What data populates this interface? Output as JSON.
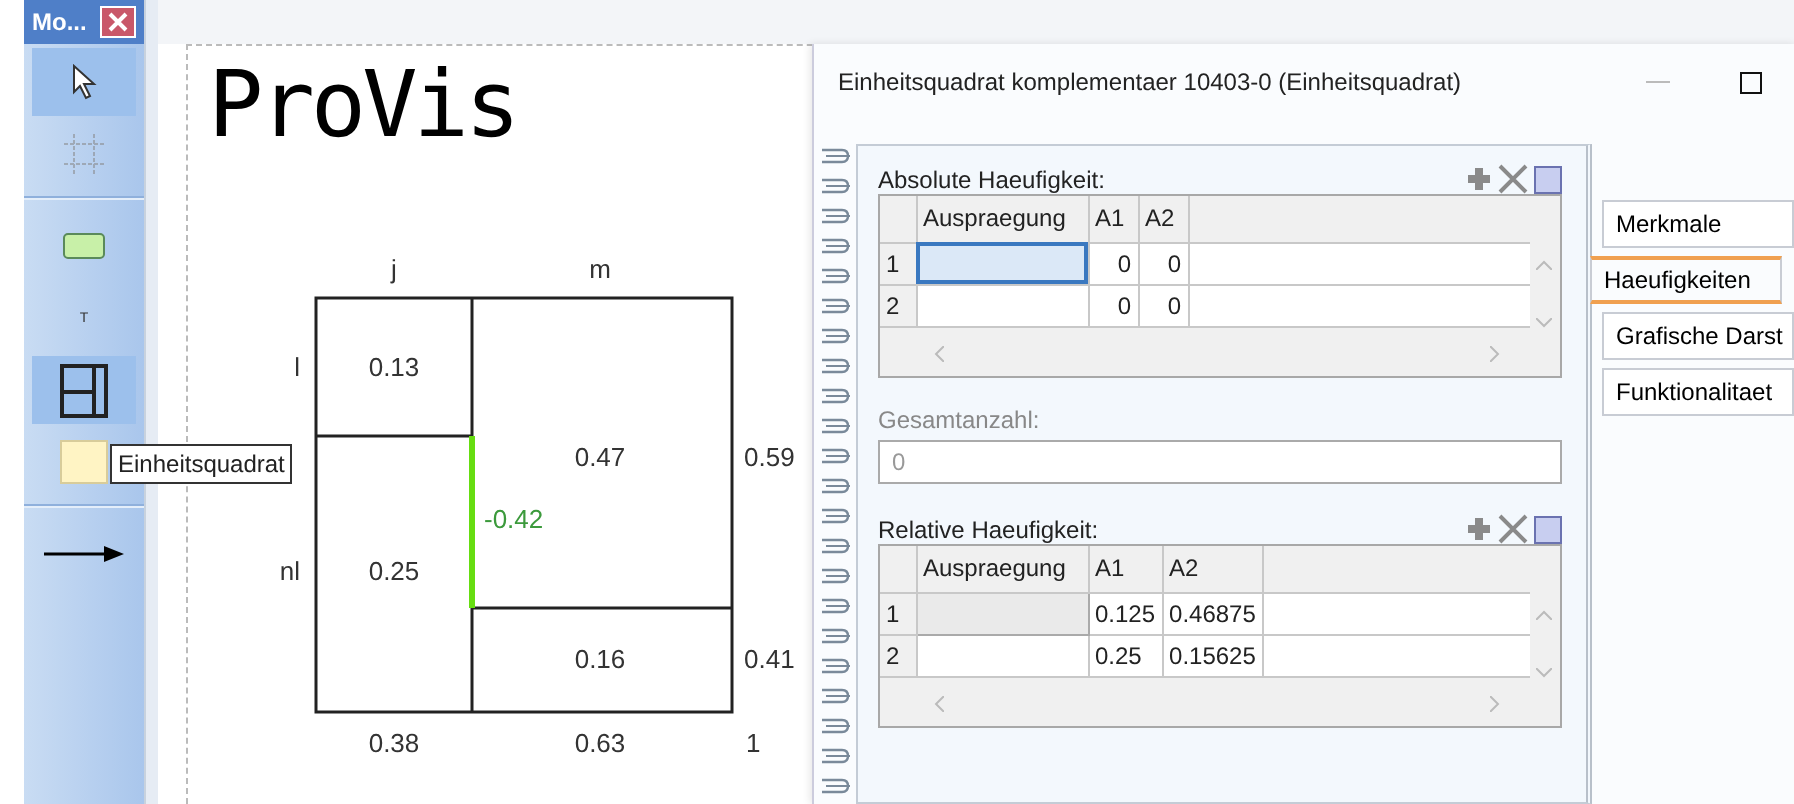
{
  "toolbox": {
    "title": "Mo...",
    "tools": [
      {
        "kind": "pointer",
        "selected": true,
        "disabled": false
      },
      {
        "kind": "grid",
        "selected": false,
        "disabled": true
      },
      {
        "kind": "rectangle",
        "selected": false,
        "disabled": false
      },
      {
        "kind": "text",
        "label": "T",
        "selected": false,
        "disabled": false
      },
      {
        "kind": "unit-square",
        "selected": true,
        "disabled": false
      },
      {
        "kind": "note",
        "selected": false,
        "disabled": false
      },
      {
        "kind": "arrow",
        "selected": false,
        "disabled": false
      }
    ]
  },
  "tooltip": "Einheitsquadrat",
  "logo": "ProVis",
  "diagram": {
    "column_labels": [
      "j",
      "m"
    ],
    "row_labels": [
      "l",
      "nl"
    ],
    "cells": [
      "0.13",
      "0.25",
      "0.47",
      "0.16"
    ],
    "right_labels": [
      "0.59",
      "0.41"
    ],
    "bottom_labels": [
      "0.38",
      "0.63",
      "1"
    ],
    "difference": "-0.42"
  },
  "dialog": {
    "title": "Einheitsquadrat komplementaer 10403-0 (Einheitsquadrat)",
    "absolute": {
      "label": "Absolute Haeufigkeit:",
      "focused": true,
      "columns": [
        "Auspraegung",
        "A1",
        "A2"
      ],
      "rows": [
        {
          "number": "1",
          "a1": "0",
          "a2": "0",
          "selected": true
        },
        {
          "number": "2",
          "a1": "0",
          "a2": "0",
          "selected": false
        }
      ]
    },
    "total": {
      "label": "Gesamtanzahl:",
      "value": "0",
      "disabled": true
    },
    "relative": {
      "label": "Relative Haeufigkeit:",
      "focused": false,
      "columns": [
        "Auspraegung",
        "A1",
        "A2"
      ],
      "rows": [
        {
          "number": "1",
          "a1": "0.125",
          "a2": "0.46875",
          "selected": true
        },
        {
          "number": "2",
          "a1": "0.25",
          "a2": "0.15625",
          "selected": false
        }
      ]
    },
    "tabs": [
      {
        "label": "Merkmale",
        "selected": false
      },
      {
        "label": "Haeufigkeiten",
        "selected": true
      },
      {
        "label": "Grafische Darst",
        "selected": false
      },
      {
        "label": "Funktionalitaet",
        "selected": false
      }
    ]
  }
}
